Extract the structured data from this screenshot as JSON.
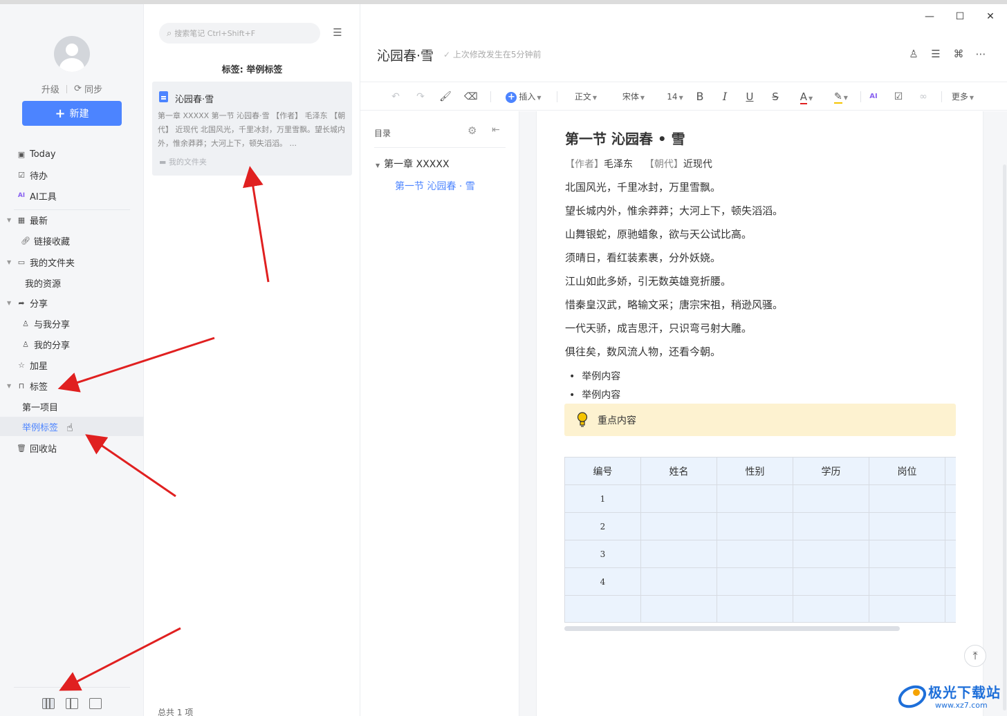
{
  "window": {
    "minimize": "—",
    "maximize": "☐",
    "close": "✕"
  },
  "sidebar": {
    "upgrade_label": "升级",
    "sync_label": "同步",
    "new_button": "新建",
    "items": [
      {
        "label": "Today",
        "icon": "calendar-icon"
      },
      {
        "label": "待办",
        "icon": "checkbox-icon"
      },
      {
        "label": "AI工具",
        "icon": "ai-icon"
      },
      {
        "label": "最新",
        "icon": "grid-icon"
      },
      {
        "label": "链接收藏",
        "icon": "link-icon"
      },
      {
        "label": "我的文件夹",
        "icon": "folder-icon"
      },
      {
        "label": "我的资源",
        "icon": ""
      },
      {
        "label": "分享",
        "icon": "share-icon"
      },
      {
        "label": "与我分享",
        "icon": "user-icon"
      },
      {
        "label": "我的分享",
        "icon": "user-icon"
      },
      {
        "label": "加星",
        "icon": "star-icon"
      },
      {
        "label": "标签",
        "icon": "bookmark-icon"
      },
      {
        "label": "第一项目",
        "icon": ""
      },
      {
        "label": "举例标签",
        "icon": ""
      },
      {
        "label": "回收站",
        "icon": "trash-icon"
      }
    ]
  },
  "list": {
    "search_placeholder": "搜索笔记 Ctrl+Shift+F",
    "tag_title": "标签: 举例标签",
    "note": {
      "title": "沁园春·雪",
      "snippet": "第一章 XXXXX 第一节 沁园春·雪 【作者】 毛泽东 【朝代】 近现代 北国风光，千里冰封，万里雪飘。望长城内外，惟余莽莽；大河上下，顿失滔滔。 ...",
      "folder": "我的文件夹"
    },
    "footer": "总共 1 项"
  },
  "editor": {
    "title": "沁园春·雪",
    "save_status": "上次修改发生在5分钟前",
    "toolbar": {
      "insert": "插入",
      "paragraph": "正文",
      "font": "宋体",
      "size": "14",
      "bold": "B",
      "italic": "I",
      "underline": "U",
      "strike": "S",
      "font_color": "A",
      "more": "更多"
    },
    "outline": {
      "title": "目录",
      "h1": "第一章  XXXXX",
      "h2": "第一节  沁园春 · 雪"
    },
    "doc": {
      "heading": "第一节  沁园春 • 雪",
      "author_label": "【作者】",
      "author": "毛泽东",
      "dynasty_label": "【朝代】",
      "dynasty": "近现代",
      "verses": [
        "北国风光，千里冰封，万里雪飘。",
        "望长城内外，惟余莽莽；大河上下，顿失滔滔。",
        "山舞银蛇，原驰蜡象，欲与天公试比高。",
        "须晴日，看红装素裹，分外妖娆。",
        "江山如此多娇，引无数英雄竞折腰。",
        "惜秦皇汉武，略输文采；唐宗宋祖，稍逊风骚。",
        "一代天骄，成吉思汗，只识弯弓射大雕。",
        "俱往矣，数风流人物，还看今朝。"
      ],
      "bullets": [
        "举例内容",
        "举例内容"
      ],
      "callout": "重点内容",
      "table": {
        "headers": [
          "编号",
          "姓名",
          "性别",
          "学历",
          "岗位",
          ""
        ],
        "rows": [
          [
            "1"
          ],
          [
            "2"
          ],
          [
            "3"
          ],
          [
            "4"
          ],
          [
            ""
          ]
        ]
      }
    }
  },
  "watermark": {
    "name": "极光下载站",
    "url": "www.xz7.com"
  },
  "colors": {
    "accent": "#4c84ff",
    "arrow": "#e02020",
    "callout_bg": "#fdf2d0",
    "table_bg": "#ebf3fd"
  }
}
